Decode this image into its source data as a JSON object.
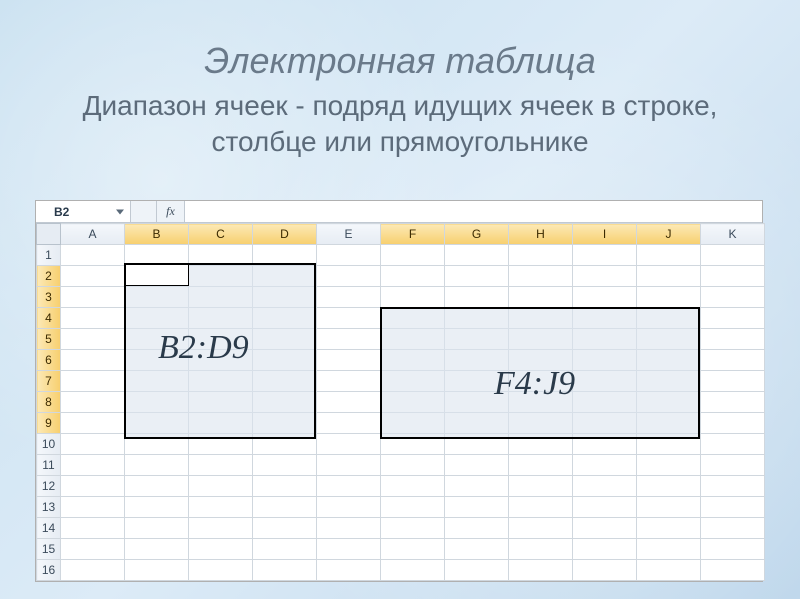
{
  "title": {
    "main": "Электронная таблица",
    "sub": "Диапазон ячеек - подряд идущих ячеек в строке, столбце или прямоугольнике"
  },
  "formula_bar": {
    "name_box": "B2",
    "fx_label": "fx",
    "formula_value": ""
  },
  "columns": [
    "A",
    "B",
    "C",
    "D",
    "E",
    "F",
    "G",
    "H",
    "I",
    "J",
    "K"
  ],
  "rows": [
    "1",
    "2",
    "3",
    "4",
    "5",
    "6",
    "7",
    "8",
    "9",
    "10",
    "11",
    "12",
    "13",
    "14",
    "15",
    "16"
  ],
  "ranges": {
    "r1": {
      "label": "B2:D9"
    },
    "r2": {
      "label": "F4:J9"
    }
  }
}
